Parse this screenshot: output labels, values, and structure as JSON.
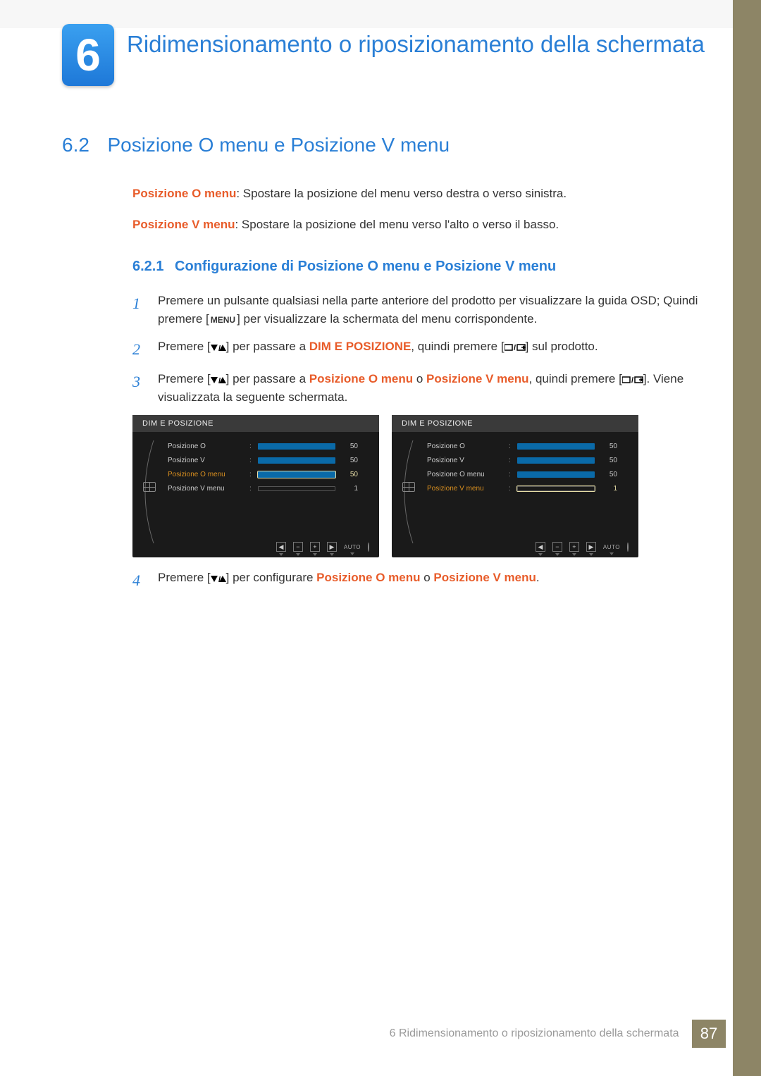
{
  "chapter": {
    "number": "6",
    "title": "Ridimensionamento o riposizionamento della schermata"
  },
  "section": {
    "number": "6.2",
    "title": "Posizione O menu e Posizione V menu"
  },
  "intro": {
    "p1_em": "Posizione O menu",
    "p1_rest": ": Spostare la posizione del menu verso destra o verso sinistra.",
    "p2_em": "Posizione V menu",
    "p2_rest": ": Spostare la posizione del menu verso l'alto o verso il basso."
  },
  "subsection": {
    "number": "6.2.1",
    "title": "Configurazione di Posizione O menu e Posizione V menu"
  },
  "steps": {
    "s1a": "Premere un pulsante qualsiasi nella parte anteriore del prodotto per visualizzare la guida OSD; Quindi premere [",
    "s1_key": "MENU",
    "s1b": "] per visualizzare la schermata del menu corrispondente.",
    "s2a": "Premere [",
    "s2b": "] per passare a ",
    "s2_em": "DIM E POSIZIONE",
    "s2c": ", quindi premere [",
    "s2d": "] sul prodotto.",
    "s3a": "Premere [",
    "s3b": "] per passare a ",
    "s3_em1": "Posizione O menu",
    "s3_mid": " o ",
    "s3_em2": "Posizione V menu",
    "s3c": ", quindi premere [",
    "s3d": "]. Viene visualizzata la seguente schermata.",
    "s4a": "Premere [",
    "s4b": "] per configurare ",
    "s4_em1": "Posizione O menu",
    "s4_mid": " o ",
    "s4_em2": "Posizione V menu",
    "s4c": "."
  },
  "osd": {
    "title": "DIM E POSIZIONE",
    "rows": [
      {
        "label": "Posizione O",
        "value": "50"
      },
      {
        "label": "Posizione V",
        "value": "50"
      },
      {
        "label": "Posizione O menu",
        "value": "50"
      },
      {
        "label": "Posizione V menu",
        "value": "1"
      }
    ],
    "right_rows": [
      {
        "label": "Posizione O",
        "value": "50"
      },
      {
        "label": "Posizione V",
        "value": "50"
      },
      {
        "label": "Posizione O menu",
        "value": "50"
      },
      {
        "label": "Posizione V menu",
        "value": "1"
      }
    ],
    "auto": "AUTO"
  },
  "footer": {
    "text": "6 Ridimensionamento o riposizionamento della schermata",
    "page": "87"
  }
}
